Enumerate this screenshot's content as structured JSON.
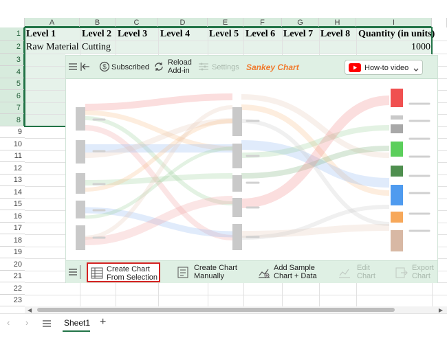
{
  "columns": [
    "A",
    "B",
    "C",
    "D",
    "E",
    "F",
    "G",
    "H",
    "I"
  ],
  "rows": [
    "1",
    "2",
    "3",
    "4",
    "5",
    "6",
    "7",
    "8",
    "9",
    "10",
    "11",
    "12",
    "13",
    "14",
    "15",
    "16",
    "17",
    "18",
    "19",
    "20",
    "21",
    "22",
    "23"
  ],
  "row1": [
    "Level 1",
    "Level 2",
    "Level 3",
    "Level 4",
    "Level 5",
    "Level 6",
    "Level 7",
    "Level 8",
    "Quantity (in units)"
  ],
  "row2": {
    "a": "Raw Material",
    "b": "Cutting",
    "i": "1000"
  },
  "addin": {
    "subscribed": "Subscribed",
    "reload_line1": "Reload",
    "reload_line2": "Add-in",
    "settings": "Settings",
    "title": "Sankey Chart",
    "howto": "How-to video",
    "create_sel_1": "Create Chart",
    "create_sel_2": "From Selection",
    "create_man_1": "Create Chart",
    "create_man_2": "Manually",
    "sample_1": "Add Sample",
    "sample_2": "Chart + Data",
    "edit_1": "Edit",
    "edit_2": "Chart",
    "export_1": "Export",
    "export_2": "Chart"
  },
  "sheet": {
    "tab": "Sheet1"
  },
  "colors": {
    "accent": "#217346",
    "brand": "#f07a2e",
    "highlight": "#d42121",
    "youtube": "#ff0000"
  }
}
